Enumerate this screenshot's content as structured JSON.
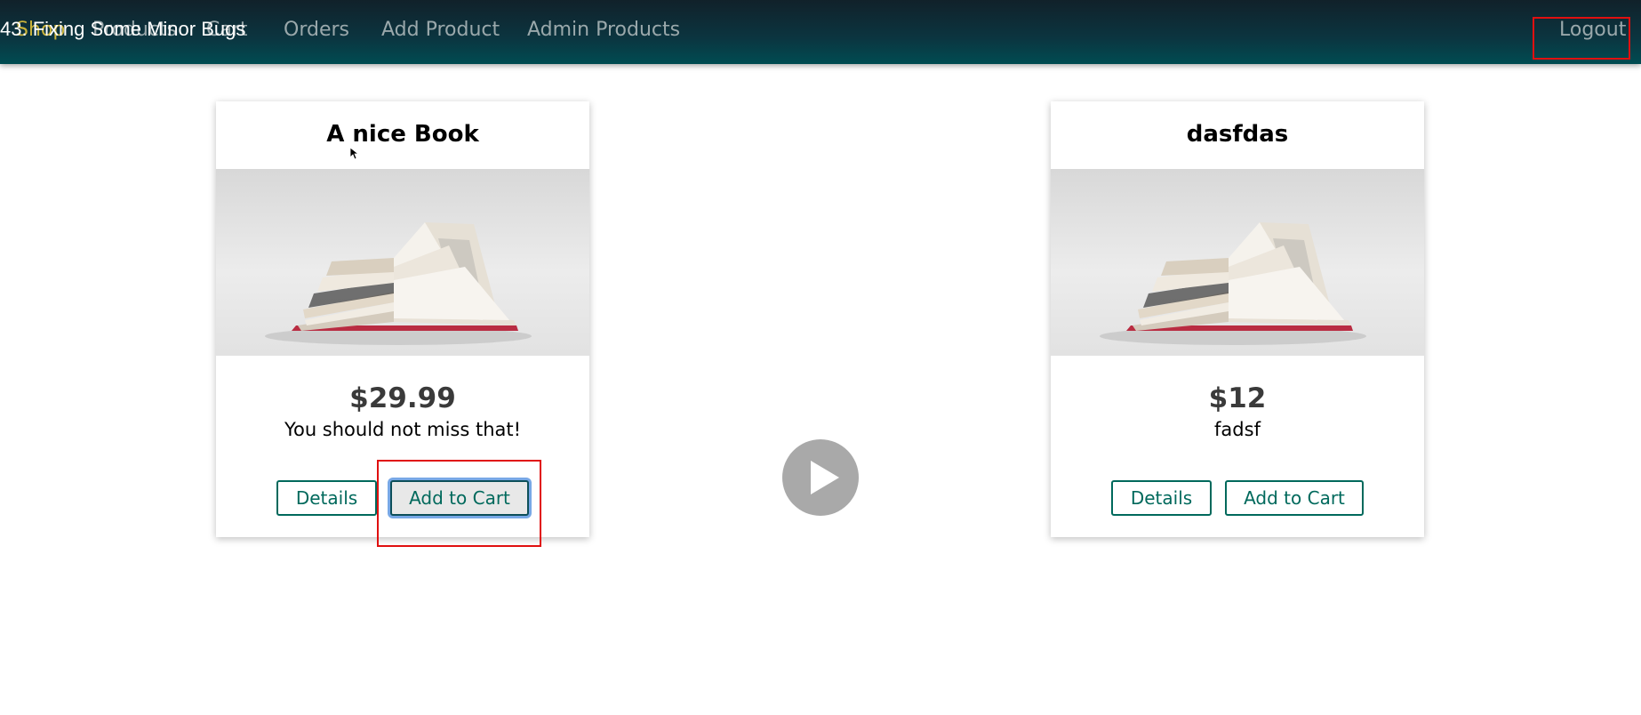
{
  "video": {
    "title": "43. Fixing Some Minor Bugs"
  },
  "navbar": {
    "brand": "Shop",
    "items": [
      "Products",
      "Cart",
      "Orders",
      "Add Product",
      "Admin Products"
    ],
    "logout": "Logout"
  },
  "products": [
    {
      "title": "A nice Book",
      "price": "$29.99",
      "description": "You should not miss that!",
      "details_label": "Details",
      "cart_label": "Add to Cart"
    },
    {
      "title": "dasfdas",
      "price": "$12",
      "description": "fadsf",
      "details_label": "Details",
      "cart_label": "Add to Cart"
    }
  ],
  "colors": {
    "accent": "#00695c",
    "highlight": "#e01010",
    "brand": "#c9b23a"
  },
  "icons": [
    "play-icon",
    "mouse-cursor-icon",
    "book-image"
  ]
}
